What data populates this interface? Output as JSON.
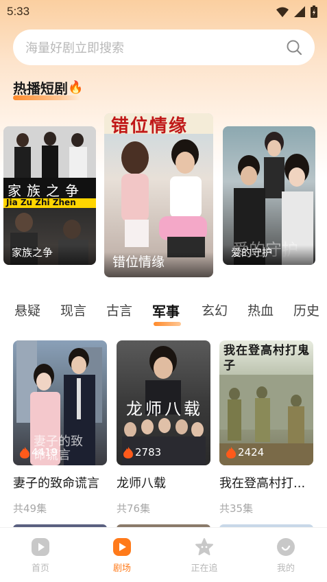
{
  "status_bar": {
    "time": "5:33"
  },
  "search": {
    "placeholder": "海量好剧立即搜索"
  },
  "hot_section": {
    "title": "热播短剧",
    "emoji": "🔥"
  },
  "hot_cards": [
    {
      "label": "家族之争",
      "poster_text": "家族之争",
      "poster_pinyin": "Jia Zu Zhi Zhen"
    },
    {
      "label": "错位情缘",
      "poster_text": "错位情缘"
    },
    {
      "label": "爱的守护",
      "poster_text": "爱的守护"
    }
  ],
  "tabs": [
    "悬疑",
    "现言",
    "古言",
    "军事",
    "玄幻",
    "热血",
    "历史"
  ],
  "active_tab": "军事",
  "dramas": [
    {
      "title": "妻子的致命谎言",
      "heat": "4419",
      "episodes": "共49集",
      "poster_text": "妻子的致命谎言"
    },
    {
      "title": "龙师八载",
      "heat": "2783",
      "episodes": "共76集",
      "poster_text": "龙师八载"
    },
    {
      "title": "我在登高村打...",
      "heat": "2424",
      "episodes": "共35集",
      "poster_text": "我在登高村打鬼子"
    }
  ],
  "bottom_nav": [
    {
      "label": "首页",
      "icon": "play-icon",
      "active": false
    },
    {
      "label": "剧场",
      "icon": "theater-icon",
      "active": true
    },
    {
      "label": "正在追",
      "icon": "star-icon",
      "active": false
    },
    {
      "label": "我的",
      "icon": "profile-icon",
      "active": false
    }
  ],
  "colors": {
    "accent": "#ff7a1a",
    "tab_inactive": "#444444",
    "nav_inactive": "#b8b8b8"
  }
}
